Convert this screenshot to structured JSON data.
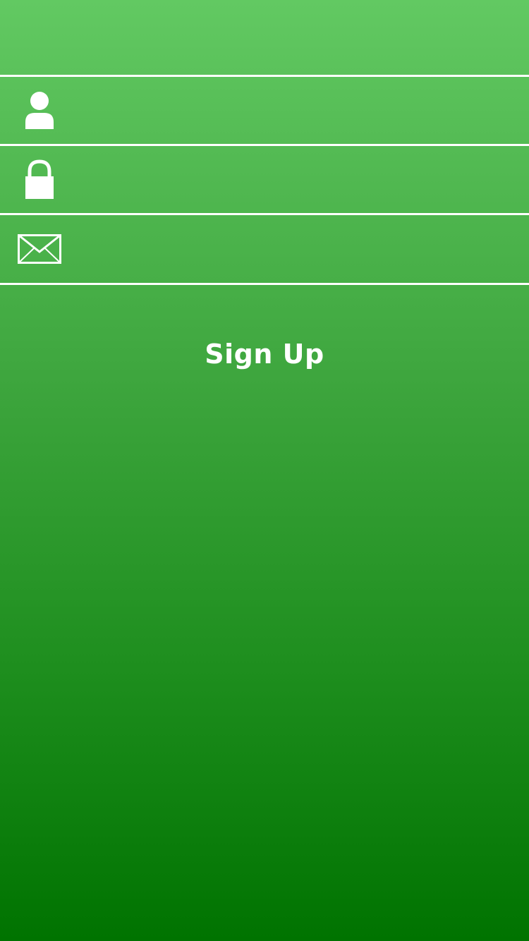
{
  "form": {
    "fields": [
      {
        "icon": "user-icon",
        "value": "",
        "placeholder": ""
      },
      {
        "icon": "lock-icon",
        "value": "",
        "placeholder": ""
      },
      {
        "icon": "mail-icon",
        "value": "",
        "placeholder": ""
      }
    ],
    "submit_label": "Sign Up"
  },
  "colors": {
    "gradient_top": "#62c962",
    "gradient_bottom": "#007300",
    "foreground": "#ffffff"
  }
}
